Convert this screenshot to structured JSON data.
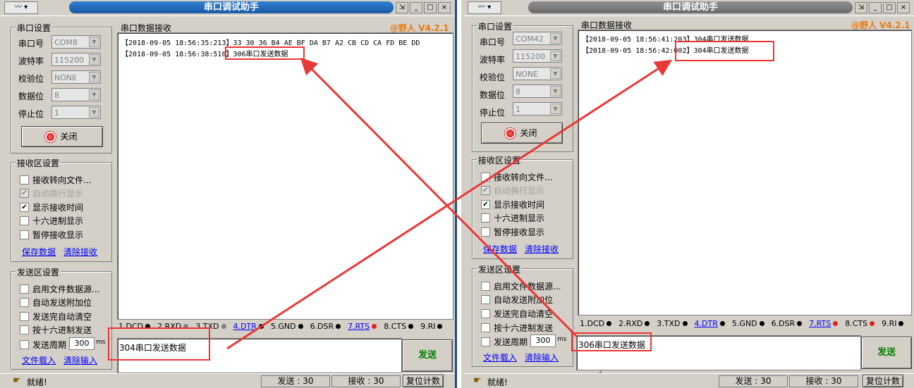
{
  "left": {
    "sysmenu": "〰 ▾",
    "title": "串口调试助手",
    "title_buttons": [
      "⇲",
      "_",
      "□",
      "×"
    ],
    "brand": "@野人 V4.2.1",
    "port_settings": {
      "title": "串口设置",
      "fields": [
        {
          "label": "串口号",
          "value": "COM8"
        },
        {
          "label": "波特率",
          "value": "115200"
        },
        {
          "label": "校验位",
          "value": "NONE"
        },
        {
          "label": "数据位",
          "value": "8"
        },
        {
          "label": "停止位",
          "value": "1"
        }
      ],
      "open_button": "关闭"
    },
    "recv_settings": {
      "title": "接收区设置",
      "options": [
        {
          "label": "接收转向文件...",
          "checked": false,
          "disabled": false
        },
        {
          "label": "自动换行显示",
          "checked": true,
          "disabled": true
        },
        {
          "label": "显示接收时间",
          "checked": true,
          "disabled": false
        },
        {
          "label": "十六进制显示",
          "checked": false,
          "disabled": false
        },
        {
          "label": "暂停接收显示",
          "checked": false,
          "disabled": false
        }
      ],
      "save_link": "保存数据",
      "clear_link": "清除接收"
    },
    "send_settings": {
      "title": "发送区设置",
      "options": [
        {
          "label": "启用文件数据源...",
          "checked": false
        },
        {
          "label": "自动发送附加位",
          "checked": false
        },
        {
          "label": "发送完自动清空",
          "checked": false
        },
        {
          "label": "按十六进制发送",
          "checked": false
        }
      ],
      "period_label": "发送周期",
      "period_value": "300",
      "period_unit": "ms",
      "load_link": "文件载入",
      "clear_link": "清除输入"
    },
    "recv_area": {
      "title": "串口数据接收",
      "lines": [
        "【2018-09-05 18:56:35:213】33 30 36 B4 AE BF DA B7 A2 CB CD CA FD BE DD",
        "【2018-09-05 18:56:38:510】306串口发送数据"
      ]
    },
    "signals": [
      {
        "label": "1.DCD",
        "color": "#000000",
        "link": false
      },
      {
        "label": "2.RXD",
        "color": "#808080",
        "link": false
      },
      {
        "label": "3.TXD",
        "color": "#808080",
        "link": false
      },
      {
        "label": "4.DTR",
        "color": "#000000",
        "link": true
      },
      {
        "label": "5.GND",
        "color": "#000000",
        "link": false
      },
      {
        "label": "6.DSR",
        "color": "#000000",
        "link": false
      },
      {
        "label": "7.RTS",
        "color": "#e02020",
        "link": true
      },
      {
        "label": "8.CTS",
        "color": "#000000",
        "link": false
      },
      {
        "label": "9.RI",
        "color": "#000000",
        "link": false
      }
    ],
    "send_text": "304串口发送数据",
    "send_button": "发送",
    "status": {
      "ready": "就绪!",
      "sent": "发送 : 30",
      "recv": "接收 : 30",
      "reset": "复位计数"
    }
  },
  "right": {
    "sysmenu": "〰 ▾",
    "title": "串口调试助手",
    "title_buttons": [
      "⇲",
      "_",
      "□",
      "×"
    ],
    "brand": "@野人 V4.2.1",
    "port_settings": {
      "title": "串口设置",
      "fields": [
        {
          "label": "串口号",
          "value": "COM42"
        },
        {
          "label": "波特率",
          "value": "115200"
        },
        {
          "label": "校验位",
          "value": "NONE"
        },
        {
          "label": "数据位",
          "value": "8"
        },
        {
          "label": "停止位",
          "value": "1"
        }
      ],
      "open_button": "关闭"
    },
    "recv_settings": {
      "title": "接收区设置",
      "options": [
        {
          "label": "接收转向文件...",
          "checked": false,
          "disabled": false
        },
        {
          "label": "自动换行显示",
          "checked": true,
          "disabled": true
        },
        {
          "label": "显示接收时间",
          "checked": true,
          "disabled": false
        },
        {
          "label": "十六进制显示",
          "checked": false,
          "disabled": false
        },
        {
          "label": "暂停接收显示",
          "checked": false,
          "disabled": false
        }
      ],
      "save_link": "保存数据",
      "clear_link": "清除接收"
    },
    "send_settings": {
      "title": "发送区设置",
      "options": [
        {
          "label": "启用文件数据源...",
          "checked": false
        },
        {
          "label": "自动发送附加位",
          "checked": false
        },
        {
          "label": "发送完自动清空",
          "checked": false
        },
        {
          "label": "按十六进制发送",
          "checked": false
        }
      ],
      "period_label": "发送周期",
      "period_value": "300",
      "period_unit": "ms",
      "load_link": "文件载入",
      "clear_link": "清除输入"
    },
    "recv_area": {
      "title": "串口数据接收",
      "lines": [
        "【2018-09-05 18:56:41:203】304串口发送数据",
        "【2018-09-05 18:56:42:002】304串口发送数据"
      ]
    },
    "signals": [
      {
        "label": "1.DCD",
        "color": "#000000",
        "link": false
      },
      {
        "label": "2.RXD",
        "color": "#000000",
        "link": false
      },
      {
        "label": "3.TXD",
        "color": "#000000",
        "link": false
      },
      {
        "label": "4.DTR",
        "color": "#000000",
        "link": true
      },
      {
        "label": "5.GND",
        "color": "#000000",
        "link": false
      },
      {
        "label": "6.DSR",
        "color": "#000000",
        "link": false
      },
      {
        "label": "7.RTS",
        "color": "#e02020",
        "link": true
      },
      {
        "label": "8.CTS",
        "color": "#e02020",
        "link": false
      },
      {
        "label": "9.RI",
        "color": "#000000",
        "link": false
      }
    ],
    "send_text": "306串口发送数据",
    "send_button": "发送",
    "status": {
      "ready": "就绪!",
      "sent": "发送 : 30",
      "recv": "接收 : 30",
      "reset": "复位计数"
    }
  },
  "annotation_color": "#e83838"
}
